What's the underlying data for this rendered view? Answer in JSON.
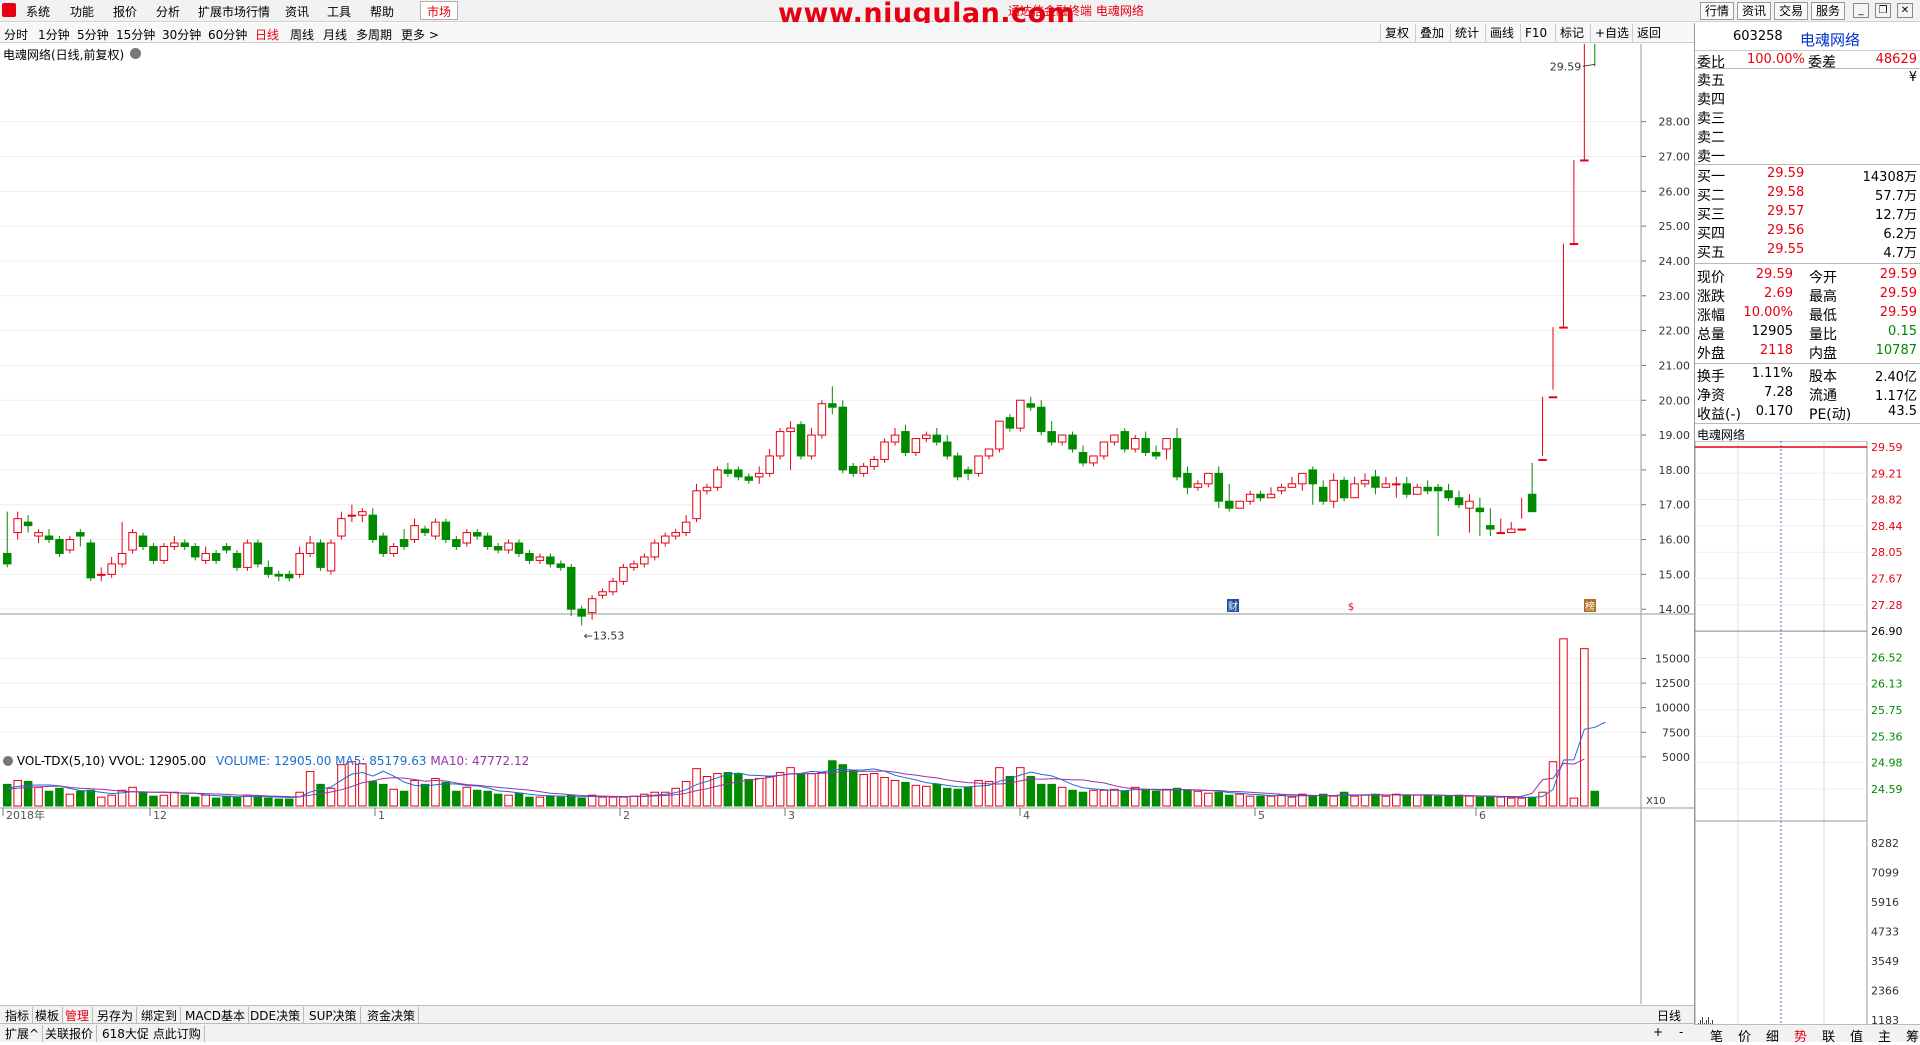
{
  "menubar": {
    "items": [
      "系统",
      "功能",
      "报价",
      "分析",
      "扩展市场行情",
      "资讯",
      "工具",
      "帮助"
    ],
    "market_button": "市场",
    "window_title": "通达信金融终端  电魂网络",
    "watermark": "www.niugulan.com",
    "right_buttons": [
      "行情",
      "资讯",
      "交易",
      "服务"
    ]
  },
  "period_bar": {
    "items": [
      "分时",
      "1分钟",
      "5分钟",
      "15分钟",
      "30分钟",
      "60分钟",
      "日线",
      "周线",
      "月线",
      "多周期",
      "更多 >"
    ],
    "active": "日线",
    "right_tools": [
      "复权",
      "叠加",
      "统计",
      "画线",
      "F10",
      "标记",
      "+自选",
      "返回"
    ]
  },
  "chart_title": "电魂网络(日线,前复权)",
  "indicator_title": {
    "name": "VOL-TDX(5,10)",
    "vvol": "VVOL: 12905.00",
    "volume": "VOLUME: 12905.00",
    "ma5": "MA5: 85179.63",
    "ma10": "MA10: 47772.12"
  },
  "chart_data": [
    {
      "type": "candlestick",
      "title": "电魂网络(日线,前复权)",
      "ylim": [
        13.0,
        29.8
      ],
      "y_ticks": [
        "14.00",
        "15.00",
        "16.00",
        "17.00",
        "18.00",
        "19.00",
        "20.00",
        "21.00",
        "22.00",
        "23.00",
        "24.00",
        "25.00",
        "26.00",
        "27.00",
        "28.00"
      ],
      "annotations": {
        "high": "29.59",
        "low": "13.53"
      },
      "x_labels": [
        "2018年",
        "12",
        "1",
        "2",
        "3",
        "4",
        "5",
        "6"
      ],
      "event_markers": [
        "财",
        "$",
        "榜"
      ],
      "closes": [
        15.3,
        16.6,
        16.4,
        16.2,
        16.0,
        15.6,
        16.0,
        16.1,
        14.9,
        15.0,
        15.3,
        15.6,
        16.2,
        15.8,
        15.4,
        15.8,
        15.9,
        15.8,
        15.5,
        15.6,
        15.4,
        15.7,
        15.2,
        15.9,
        15.3,
        15.0,
        14.95,
        14.9,
        15.6,
        15.9,
        15.2,
        15.9,
        16.6,
        16.7,
        16.8,
        16.0,
        15.6,
        15.8,
        15.8,
        16.4,
        16.2,
        16.5,
        16.0,
        15.8,
        16.2,
        16.1,
        15.8,
        15.7,
        15.9,
        15.6,
        15.4,
        15.5,
        15.3,
        15.2,
        14.0,
        13.8,
        14.3,
        14.5,
        14.8,
        15.2,
        15.3,
        15.5,
        15.9,
        16.1,
        16.2,
        16.5,
        17.4,
        17.5,
        18.0,
        17.9,
        17.8,
        17.7,
        17.9,
        18.4,
        19.1,
        19.2,
        18.4,
        19.0,
        19.9,
        19.8,
        18.0,
        17.9,
        18.1,
        18.3,
        18.8,
        19.0,
        18.5,
        18.9,
        19.0,
        18.8,
        18.4,
        17.8,
        17.9,
        18.4,
        18.6,
        19.4,
        19.2,
        20.0,
        19.8,
        19.1,
        18.8,
        19.0,
        18.6,
        18.2,
        18.4,
        18.8,
        19.0,
        18.6,
        18.9,
        18.5,
        18.4,
        18.9,
        17.8,
        17.5,
        17.6,
        17.9,
        17.1,
        16.9,
        17.1,
        17.3,
        17.2,
        17.3,
        17.5,
        17.6,
        17.9,
        17.6,
        17.1,
        17.7,
        17.2,
        17.6,
        17.7,
        17.5,
        17.6,
        17.6,
        17.3,
        17.5,
        17.4,
        17.4,
        17.2,
        17.0,
        17.1,
        16.8,
        16.3,
        16.2,
        16.3,
        16.3,
        16.8,
        18.3,
        20.1,
        22.1,
        24.5,
        26.9,
        29.59
      ],
      "opens": [
        15.6,
        16.2,
        16.5,
        16.1,
        16.1,
        16.0,
        15.7,
        16.2,
        15.9,
        15.0,
        15.0,
        15.3,
        15.7,
        16.1,
        15.8,
        15.4,
        15.8,
        15.9,
        15.8,
        15.4,
        15.6,
        15.8,
        15.6,
        15.2,
        15.9,
        15.2,
        15.0,
        15.0,
        15.0,
        15.6,
        15.9,
        15.1,
        16.1,
        16.7,
        16.7,
        16.7,
        16.1,
        15.6,
        16.0,
        16.0,
        16.3,
        16.1,
        16.5,
        16.0,
        15.9,
        16.2,
        16.1,
        15.8,
        15.7,
        15.9,
        15.6,
        15.4,
        15.5,
        15.3,
        15.2,
        14.0,
        13.9,
        14.4,
        14.5,
        14.8,
        15.2,
        15.3,
        15.5,
        15.9,
        16.1,
        16.2,
        16.6,
        17.4,
        17.5,
        18.0,
        18.0,
        17.8,
        17.8,
        17.9,
        18.4,
        19.1,
        19.3,
        18.4,
        19.0,
        19.9,
        19.8,
        18.1,
        17.9,
        18.1,
        18.3,
        18.8,
        19.1,
        18.5,
        18.9,
        19.0,
        18.8,
        18.4,
        18.0,
        17.9,
        18.4,
        18.6,
        19.5,
        19.2,
        19.9,
        19.8,
        19.1,
        18.8,
        19.0,
        18.5,
        18.2,
        18.4,
        18.8,
        19.1,
        18.6,
        18.9,
        18.5,
        18.6,
        18.9,
        17.9,
        17.5,
        17.6,
        17.9,
        17.1,
        16.9,
        17.1,
        17.3,
        17.2,
        17.4,
        17.5,
        17.6,
        18.0,
        17.5,
        17.1,
        17.7,
        17.2,
        17.6,
        17.8,
        17.5,
        17.6,
        17.6,
        17.3,
        17.5,
        17.5,
        17.4,
        17.2,
        16.9,
        16.9,
        16.4,
        16.2,
        16.2,
        16.3,
        17.3,
        18.3,
        20.1,
        22.1,
        24.5,
        26.9
      ],
      "highs": [
        16.8,
        16.8,
        16.7,
        16.3,
        16.3,
        16.1,
        16.1,
        16.3,
        16.0,
        15.2,
        15.5,
        16.5,
        16.3,
        16.2,
        15.9,
        15.9,
        16.1,
        16.0,
        15.9,
        15.8,
        15.7,
        15.9,
        15.7,
        16.0,
        16.0,
        15.4,
        15.1,
        15.1,
        15.8,
        16.1,
        16.0,
        16.0,
        16.8,
        17.0,
        16.9,
        16.9,
        16.2,
        15.9,
        16.3,
        16.6,
        16.4,
        16.6,
        16.6,
        16.1,
        16.3,
        16.3,
        16.2,
        15.9,
        16.0,
        16.0,
        15.7,
        15.6,
        15.6,
        15.4,
        15.3,
        14.1,
        14.4,
        14.6,
        14.9,
        15.3,
        15.4,
        15.6,
        16.0,
        16.2,
        16.3,
        16.7,
        17.6,
        17.6,
        18.1,
        18.2,
        18.1,
        17.9,
        18.1,
        18.6,
        19.2,
        19.4,
        19.4,
        19.2,
        20.0,
        20.4,
        20.0,
        18.2,
        18.2,
        18.4,
        18.9,
        19.2,
        19.3,
        18.6,
        19.1,
        19.2,
        19.0,
        18.5,
        18.1,
        18.1,
        18.5,
        18.8,
        19.6,
        19.4,
        20.1,
        20.0,
        19.4,
        19.0,
        19.1,
        18.7,
        18.4,
        18.6,
        18.9,
        19.2,
        19.0,
        19.1,
        18.7,
        18.8,
        19.2,
        18.1,
        17.7,
        17.8,
        18.1,
        17.6,
        17.1,
        17.4,
        17.4,
        17.5,
        17.6,
        17.8,
        17.8,
        18.1,
        17.7,
        17.9,
        17.8,
        17.8,
        17.9,
        18.0,
        17.8,
        17.8,
        17.8,
        17.6,
        17.7,
        17.6,
        17.6,
        17.4,
        17.3,
        17.2,
        16.9,
        16.6,
        16.5,
        16.6,
        16.9,
        18.4,
        20.3,
        22.1,
        24.5,
        26.9,
        29.59
      ],
      "lows": [
        15.2,
        16.0,
        16.2,
        15.9,
        15.9,
        15.5,
        15.6,
        15.8,
        14.8,
        14.8,
        14.9,
        15.2,
        15.6,
        15.7,
        15.3,
        15.3,
        15.7,
        15.7,
        15.4,
        15.3,
        15.3,
        15.6,
        15.1,
        15.1,
        15.2,
        14.9,
        14.8,
        14.8,
        14.9,
        15.5,
        15.1,
        15.0,
        16.0,
        16.5,
        16.5,
        15.9,
        15.5,
        15.5,
        15.7,
        15.9,
        16.1,
        16.0,
        15.9,
        15.7,
        15.8,
        16.0,
        15.7,
        15.6,
        15.6,
        15.5,
        15.3,
        15.3,
        15.2,
        15.1,
        13.8,
        13.53,
        13.7,
        14.3,
        14.4,
        14.7,
        15.1,
        15.2,
        15.4,
        15.8,
        16.0,
        16.1,
        16.5,
        17.3,
        17.4,
        17.8,
        17.7,
        17.6,
        17.6,
        17.8,
        18.3,
        18.0,
        18.3,
        18.3,
        18.9,
        19.6,
        17.9,
        17.8,
        17.8,
        18.0,
        18.2,
        18.7,
        18.4,
        18.4,
        18.8,
        18.7,
        18.3,
        17.7,
        17.7,
        17.8,
        18.3,
        18.5,
        19.1,
        19.1,
        19.7,
        19.0,
        18.7,
        18.7,
        18.5,
        18.1,
        18.1,
        18.3,
        18.7,
        18.5,
        18.5,
        18.4,
        18.3,
        18.3,
        17.7,
        17.3,
        17.4,
        17.5,
        16.9,
        16.8,
        16.9,
        17.0,
        17.1,
        17.2,
        17.3,
        17.5,
        17.4,
        17.0,
        17.0,
        16.9,
        17.1,
        17.2,
        17.5,
        17.3,
        17.5,
        17.2,
        17.2,
        17.3,
        17.3,
        16.1,
        17.1,
        16.9,
        16.2,
        16.1,
        16.1,
        16.2,
        16.3,
        17.2,
        18.2,
        20.1,
        22.1,
        24.5,
        26.9
      ]
    },
    {
      "type": "bar",
      "title": "VOL-TDX(5,10)",
      "y_ticks": [
        "5000",
        "7500",
        "10000",
        "12500",
        "15000"
      ],
      "ylim": [
        0,
        18000
      ],
      "scale_label": "X10",
      "volumes": [
        2200,
        2600,
        2500,
        1900,
        1500,
        1800,
        1200,
        1500,
        1600,
        900,
        1100,
        1600,
        1900,
        1400,
        1000,
        1100,
        1400,
        1100,
        900,
        1100,
        800,
        1000,
        900,
        1100,
        1000,
        800,
        700,
        700,
        1400,
        3500,
        2200,
        1800,
        4200,
        4500,
        4300,
        2500,
        2200,
        1700,
        1500,
        2600,
        2200,
        2800,
        2400,
        1500,
        1900,
        1600,
        1500,
        1200,
        1100,
        1300,
        900,
        900,
        1000,
        900,
        1100,
        800,
        1100,
        900,
        900,
        900,
        1000,
        1200,
        1400,
        1400,
        1800,
        2500,
        3800,
        3000,
        3300,
        3400,
        3300,
        2700,
        2800,
        3000,
        3400,
        3900,
        3200,
        3300,
        3400,
        4600,
        4200,
        3600,
        3200,
        3300,
        2900,
        2600,
        2400,
        2100,
        2000,
        2200,
        1800,
        1700,
        1900,
        2600,
        2500,
        3900,
        3000,
        3900,
        3000,
        2200,
        2200,
        1900,
        1600,
        1400,
        1600,
        1600,
        1700,
        1500,
        1900,
        1700,
        1500,
        1700,
        1800,
        1600,
        1500,
        1300,
        1400,
        1100,
        1200,
        1000,
        1000,
        1000,
        1100,
        900,
        1200,
        1000,
        1200,
        1000,
        1400,
        1000,
        1100,
        1200,
        1000,
        1200,
        1100,
        1100,
        1100,
        1000,
        1000,
        1100,
        1000,
        900,
        1000,
        900,
        800,
        800,
        900,
        1400,
        4500,
        17000,
        800,
        16000,
        1500
      ],
      "ma5": [
        1800,
        2000,
        2100,
        2140,
        2140,
        2060,
        1780,
        1580,
        1520,
        1400,
        1260,
        1340,
        1460,
        1380,
        1400,
        1420,
        1360,
        1300,
        1300,
        1120,
        1060,
        980,
        940,
        980,
        960,
        940,
        900,
        860,
        920,
        1420,
        1720,
        1920,
        2620,
        3240,
        3400,
        3040,
        3540,
        3040,
        2440,
        2100,
        2040,
        2160,
        2260,
        2240,
        2080,
        2040,
        1840,
        1540,
        1460,
        1340,
        1200,
        1080,
        1040,
        1000,
        960,
        940,
        980,
        960,
        960,
        920,
        980,
        1000,
        1100,
        1180,
        1360,
        1660,
        2180,
        2500,
        2880,
        3200,
        3360,
        3140,
        3100,
        3040,
        3120,
        3260,
        3320,
        3520,
        3440,
        3680,
        3740,
        3660,
        3660,
        3780,
        3540,
        3120,
        2880,
        2660,
        2360,
        2260,
        2100,
        1960,
        1940,
        2040,
        2100,
        2520,
        2780,
        3140,
        3460,
        3220,
        3060,
        2660,
        2180,
        1860,
        1740,
        1660,
        1580,
        1560,
        1660,
        1680,
        1700,
        1660,
        1680,
        1660,
        1620,
        1580,
        1520,
        1360,
        1300,
        1200,
        1140,
        1060,
        1060,
        1000,
        1040,
        1040,
        1080,
        1060,
        1160,
        1120,
        1140,
        1160,
        1120,
        1120,
        1120,
        1120,
        1140,
        1100,
        1060,
        1060,
        1040,
        1000,
        980,
        940,
        900,
        880,
        880,
        960,
        1680,
        4680,
        4700,
        7800,
        8000,
        8517.963
      ],
      "ma10": [
        1700,
        1800,
        1900,
        1950,
        2000,
        2030,
        1900,
        1800,
        1750,
        1700,
        1600,
        1500,
        1450,
        1450,
        1400,
        1380,
        1350,
        1320,
        1300,
        1260,
        1220,
        1180,
        1120,
        1100,
        1080,
        1020,
        990,
        950,
        940,
        1100,
        1260,
        1420,
        1660,
        1980,
        2360,
        2550,
        2800,
        2880,
        2830,
        2700,
        2520,
        2600,
        2540,
        2340,
        2170,
        2110,
        1990,
        1890,
        1800,
        1700,
        1620,
        1460,
        1300,
        1230,
        1150,
        1070,
        1030,
        1000,
        980,
        960,
        960,
        980,
        1030,
        1070,
        1150,
        1290,
        1560,
        1760,
        2020,
        2260,
        2480,
        2610,
        2770,
        2900,
        3130,
        3280,
        3280,
        3280,
        3330,
        3400,
        3520,
        3490,
        3530,
        3530,
        3560,
        3440,
        3250,
        3140,
        2980,
        2860,
        2650,
        2490,
        2380,
        2330,
        2250,
        2240,
        2330,
        2560,
        2770,
        2720,
        2780,
        2720,
        2660,
        2660,
        2480,
        2350,
        2070,
        1850,
        1760,
        1700,
        1640,
        1620,
        1640,
        1660,
        1630,
        1590,
        1580,
        1490,
        1460,
        1400,
        1330,
        1270,
        1190,
        1150,
        1120,
        1080,
        1050,
        1060,
        1080,
        1090,
        1110,
        1130,
        1120,
        1140,
        1150,
        1130,
        1130,
        1110,
        1080,
        1060,
        1050,
        1030,
        1000,
        980,
        960,
        980,
        1290,
        2680,
        2820,
        4340,
        4260,
        4777.212
      ]
    }
  ],
  "right_panel": {
    "code": "603258",
    "name": "电魂网络",
    "weibi_label": "委比",
    "weibi_value": "100.00%",
    "weicha_label": "委差",
    "weicha_value": "48629",
    "asks": [
      {
        "label": "卖五",
        "price": "",
        "vol": "¥"
      },
      {
        "label": "卖四",
        "price": "",
        "vol": ""
      },
      {
        "label": "卖三",
        "price": "",
        "vol": ""
      },
      {
        "label": "卖二",
        "price": "",
        "vol": ""
      },
      {
        "label": "卖一",
        "price": "",
        "vol": ""
      }
    ],
    "bids": [
      {
        "label": "买一",
        "price": "29.59",
        "vol": "14308万"
      },
      {
        "label": "买二",
        "price": "29.58",
        "vol": "57.7万"
      },
      {
        "label": "买三",
        "price": "29.57",
        "vol": "12.7万"
      },
      {
        "label": "买四",
        "price": "29.56",
        "vol": "6.2万"
      },
      {
        "label": "买五",
        "price": "29.55",
        "vol": "4.7万"
      }
    ],
    "quote": [
      {
        "l1": "现价",
        "v1": "29.59",
        "l2": "今开",
        "v2": "29.59",
        "c1": "red",
        "c2": "red"
      },
      {
        "l1": "涨跌",
        "v1": "2.69",
        "l2": "最高",
        "v2": "29.59",
        "c1": "red",
        "c2": "red"
      },
      {
        "l1": "涨幅",
        "v1": "10.00%",
        "l2": "最低",
        "v2": "29.59",
        "c1": "red",
        "c2": "red"
      },
      {
        "l1": "总量",
        "v1": "12905",
        "l2": "量比",
        "v2": "0.15",
        "c1": "black",
        "c2": "green"
      },
      {
        "l1": "外盘",
        "v1": "2118",
        "l2": "内盘",
        "v2": "10787",
        "c1": "red",
        "c2": "green"
      }
    ],
    "fund": [
      {
        "l1": "换手",
        "v1": "1.11%",
        "l2": "股本",
        "v2": "2.40亿"
      },
      {
        "l1": "净资",
        "v1": "7.28",
        "l2": "流通",
        "v2": "1.17亿"
      },
      {
        "l1": "收益(-)",
        "v1": "0.170",
        "l2": "PE(动)",
        "v2": "43.5"
      }
    ],
    "mini_title": "电魂网络",
    "mini_price_ticks": [
      "29.59",
      "29.21",
      "28.82",
      "28.44",
      "28.05",
      "27.67",
      "27.28",
      "26.90",
      "26.52",
      "26.13",
      "25.75",
      "25.36",
      "24.98",
      "24.59"
    ],
    "mini_vol_ticks": [
      "8282",
      "7099",
      "5916",
      "4733",
      "3549",
      "2366",
      "1183"
    ],
    "tabs": [
      "笔",
      "价",
      "细",
      "势",
      "联",
      "值",
      "主",
      "筹"
    ],
    "active_tab": "势"
  },
  "bottom_bar": {
    "tabs": [
      "指标",
      "模板",
      "管理",
      "另存为",
      "绑定到",
      "MACD基本",
      "DDE决策",
      "SUP决策",
      "资金决策"
    ],
    "active": "管理",
    "ext": [
      "扩展^",
      "关联报价",
      "618大促 点此订购"
    ],
    "period_label": "日线",
    "plus": "+",
    "minus": "-"
  }
}
